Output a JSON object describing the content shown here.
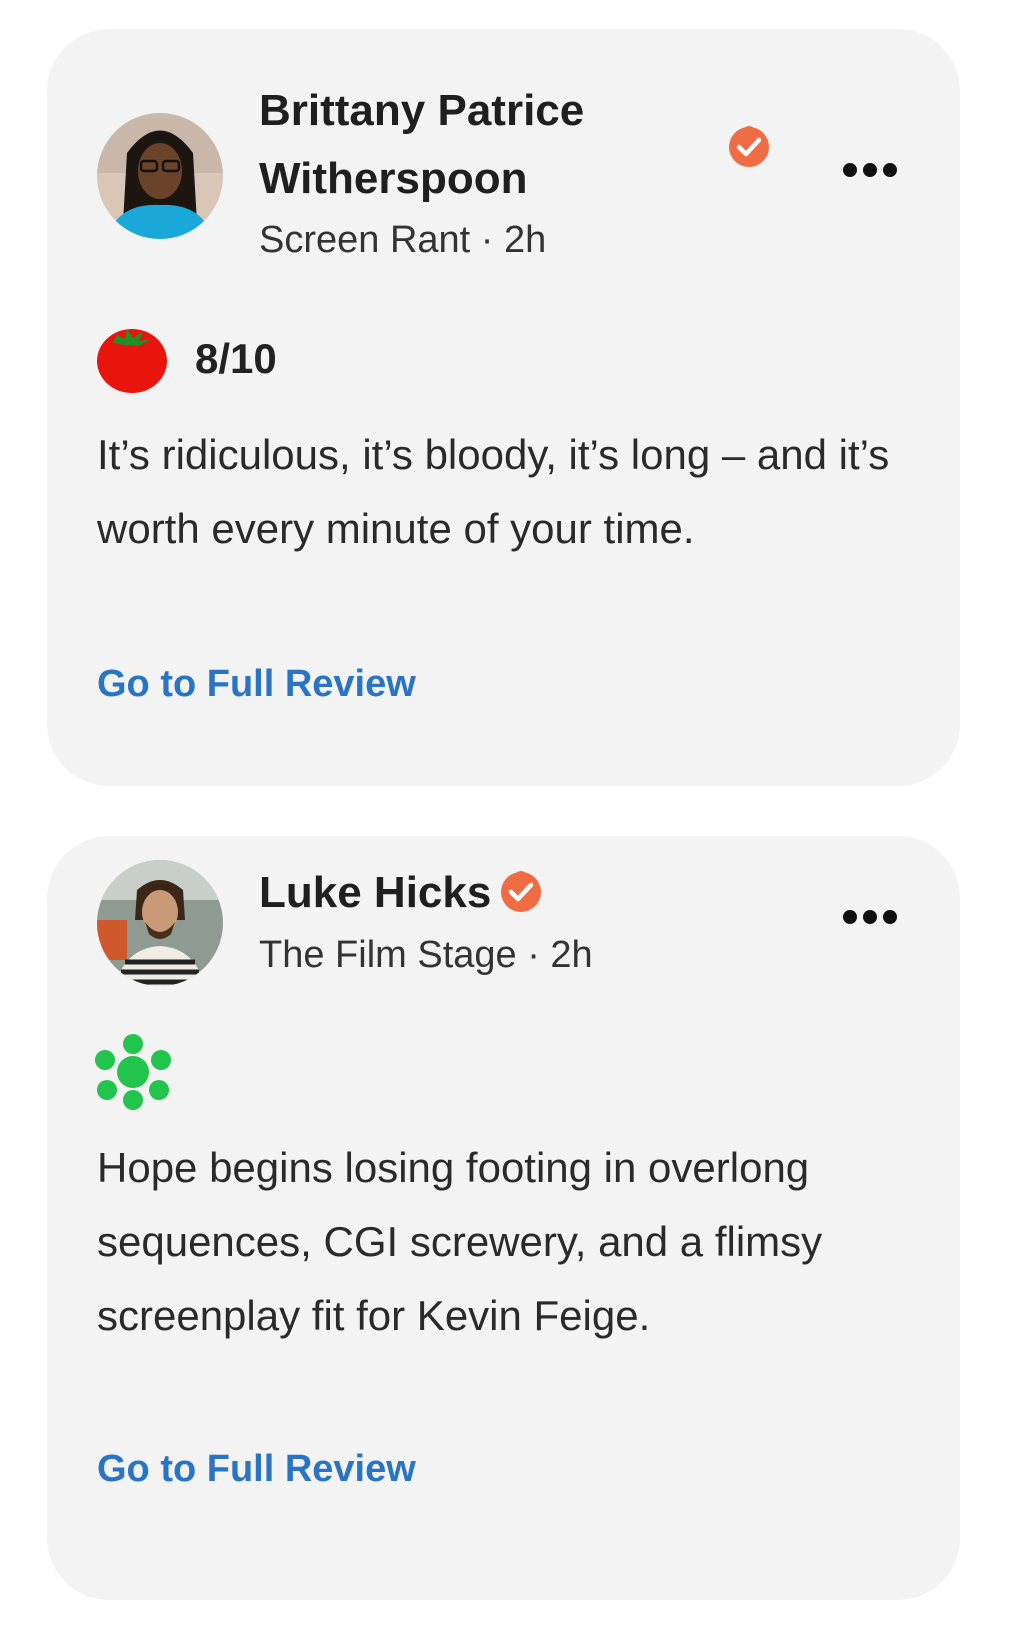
{
  "colors": {
    "card_bg": "#f3f3f3",
    "link": "#2a74c5",
    "badge": "#ef6c45",
    "tomato": "#e8150d",
    "splat": "#22c44b"
  },
  "reviews": [
    {
      "critic_name_line1": "Brittany Patrice",
      "critic_name_line2": "Witherspoon",
      "publication_time": "Screen Rant · 2h",
      "verified_icon": "verified-critic-badge-icon",
      "rating_icon": "fresh-tomato-icon",
      "score": "8/10",
      "quote": "It’s ridiculous, it’s bloody, it’s long – and it’s worth every minute of your time.",
      "link_label": "Go to Full Review"
    },
    {
      "critic_name": "Luke Hicks",
      "publication_time": "The Film Stage · 2h",
      "verified_icon": "verified-critic-badge-icon",
      "rating_icon": "rotten-splat-icon",
      "quote": "Hope begins losing footing in overlong sequences, CGI screwery, and a flimsy screenplay fit for Kevin Feige.",
      "link_label": "Go to Full Review"
    }
  ]
}
